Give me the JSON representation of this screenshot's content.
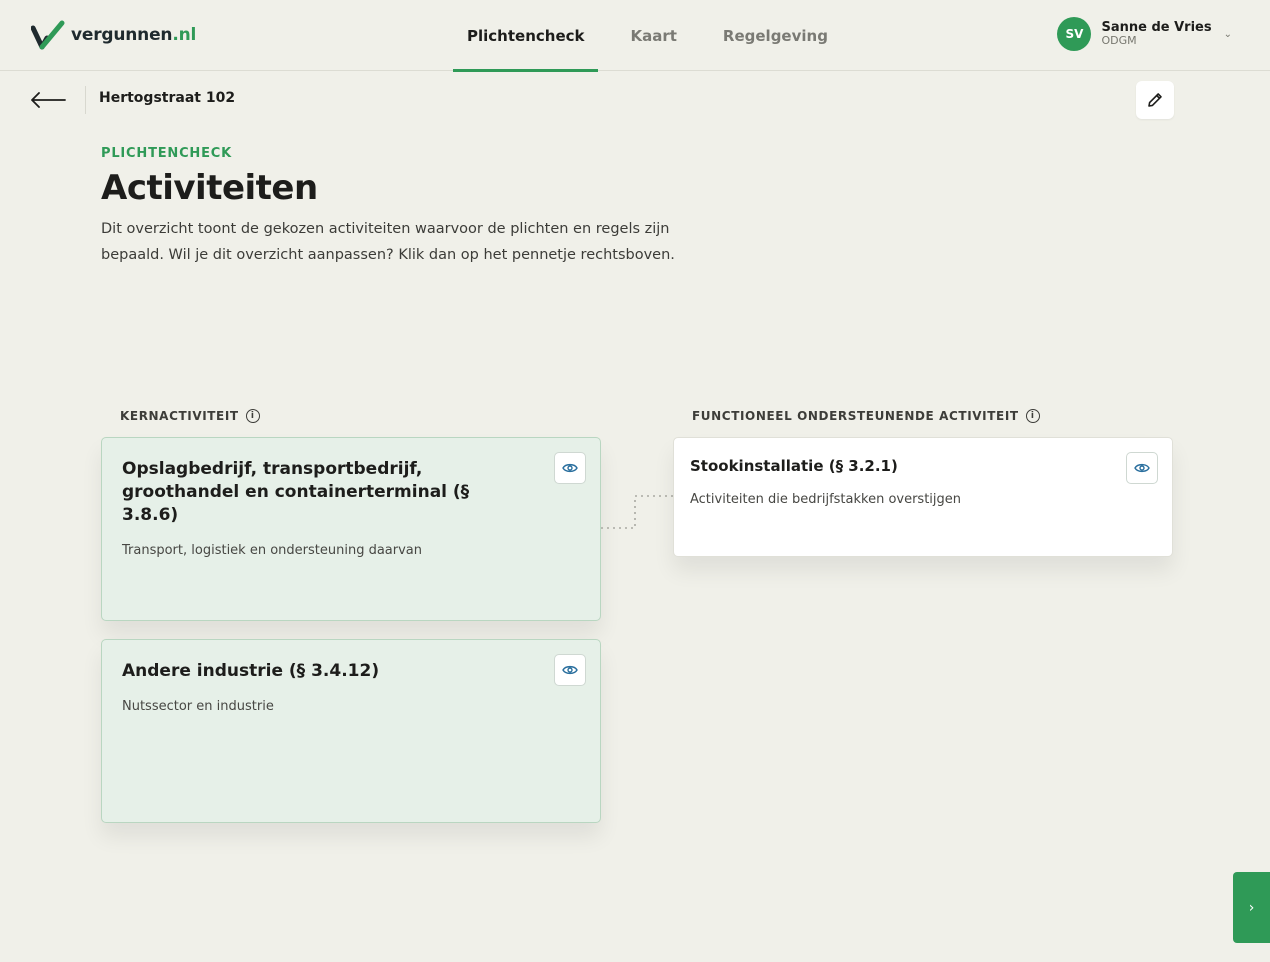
{
  "header": {
    "logo_name": "vergunnen",
    "logo_tld": ".nl",
    "tabs": [
      {
        "label": "Plichtencheck",
        "active": true
      },
      {
        "label": "Kaart",
        "active": false
      },
      {
        "label": "Regelgeving",
        "active": false
      }
    ],
    "user": {
      "initials": "SV",
      "name": "Sanne de Vries",
      "org": "ODGM"
    }
  },
  "subheader": {
    "address": "Hertogstraat 102"
  },
  "main": {
    "eyebrow": "PLICHTENCHECK",
    "title": "Activiteiten",
    "intro": "Dit overzicht toont de gekozen activiteiten waarvoor de plichten en regels zijn bepaald. Wil je dit overzicht aanpassen? Klik dan op het pennetje rechtsboven."
  },
  "core": {
    "label": "KERNACTIVITEIT",
    "cards": [
      {
        "title": "Opslagbedrijf, transportbedrijf, groothandel en containerterminal (§ 3.8.6)",
        "desc": "Transport, logistiek en ondersteuning daarvan"
      },
      {
        "title": "Andere industrie (§ 3.4.12)",
        "desc": "Nutssector en industrie"
      }
    ]
  },
  "support": {
    "label": "FUNCTIONEEL ONDERSTEUNENDE ACTIVITEIT",
    "cards": [
      {
        "title": "Stookinstallatie (§ 3.2.1)",
        "desc": "Activiteiten die bedrijfstakken overstijgen"
      }
    ]
  },
  "icons": {
    "back": "arrow-left-icon",
    "edit": "pencil-icon",
    "info": "info-icon",
    "view": "eye-icon",
    "next": "chevron-right-icon"
  },
  "colors": {
    "accent": "#2f9a57",
    "background": "#f0f0e9",
    "core_card": "#e6f0e8"
  }
}
